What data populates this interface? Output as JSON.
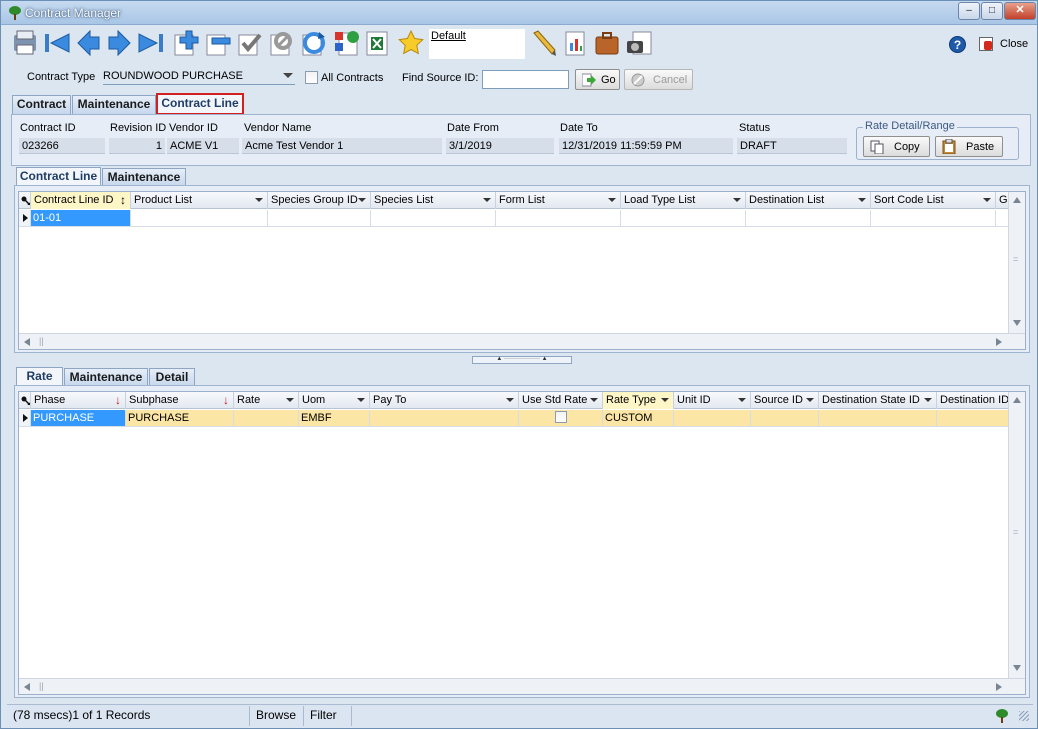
{
  "window": {
    "title": "Contract Manager"
  },
  "toolbar": {
    "layout_name": "Default",
    "close_label": "Close"
  },
  "filter": {
    "contract_type_label": "Contract Type",
    "contract_type_value": "ROUNDWOOD PURCHASE",
    "all_contracts_label": "All Contracts",
    "find_source_label": "Find Source ID:",
    "go_label": "Go",
    "cancel_label": "Cancel"
  },
  "main_tabs": [
    "Contract",
    "Maintenance",
    "Contract Line"
  ],
  "header": {
    "labels": [
      "Contract ID",
      "Revision ID",
      "Vendor ID",
      "Vendor Name",
      "Date From",
      "Date To",
      "Status"
    ],
    "values": [
      "023266",
      "1",
      "ACME V1",
      "Acme Test Vendor 1",
      "3/1/2019",
      "12/31/2019 11:59:59 PM",
      "DRAFT"
    ],
    "rate_group_label": "Rate Detail/Range",
    "copy_label": "Copy",
    "paste_label": "Paste"
  },
  "line_tabs": [
    "Contract Line",
    "Maintenance"
  ],
  "line_grid": {
    "columns": [
      "Contract Line ID",
      "Product List",
      "Species Group ID",
      "Species List",
      "Form List",
      "Load Type List",
      "Destination List",
      "Sort Code List",
      "Gr"
    ],
    "rows": [
      [
        "01-01",
        "",
        "",
        "",
        "",
        "",
        "",
        "",
        ""
      ]
    ]
  },
  "rate_tabs": [
    "Rate",
    "Maintenance",
    "Detail"
  ],
  "rate_grid": {
    "columns": [
      "Phase",
      "Subphase",
      "Rate",
      "Uom",
      "Pay To",
      "Use Std Rate",
      "Rate Type",
      "Unit ID",
      "Source ID",
      "Destination State ID",
      "Destination ID"
    ],
    "rows": [
      [
        "PURCHASE",
        "PURCHASE",
        "",
        "EMBF",
        "",
        "",
        "CUSTOM",
        "",
        "",
        "",
        ""
      ]
    ]
  },
  "status_bar": {
    "records": "(78 msecs)1 of 1 Records",
    "mode": "Browse",
    "filter": "Filter"
  }
}
